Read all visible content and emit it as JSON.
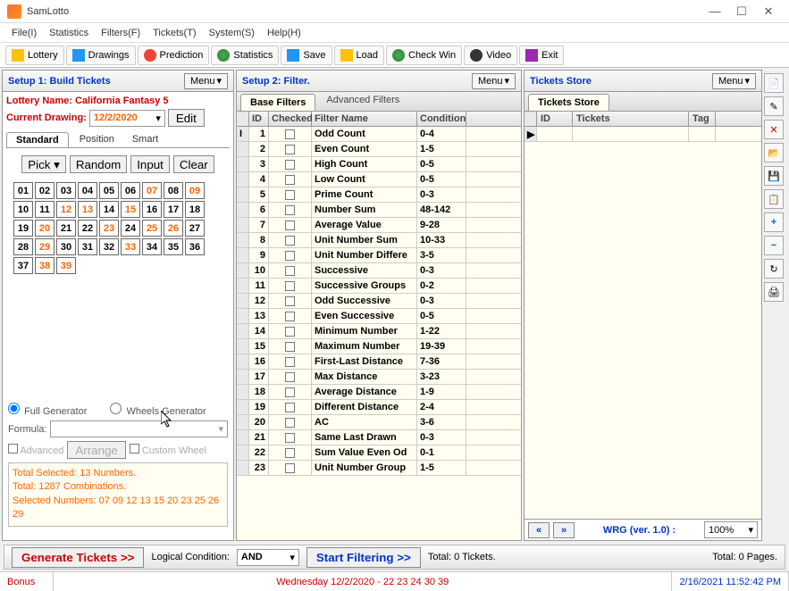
{
  "title": "SamLotto",
  "menubar": [
    "File(I)",
    "Statistics",
    "Filters(F)",
    "Tickets(T)",
    "System(S)",
    "Help(H)"
  ],
  "toolbar": [
    "Lottery",
    "Drawings",
    "Prediction",
    "Statistics",
    "Save",
    "Load",
    "Check Win",
    "Video",
    "Exit"
  ],
  "panel1": {
    "title": "Setup 1: Build  Tickets",
    "menu": "Menu",
    "lottery_label": "Lottery  Name:",
    "lottery_name": " California Fantasy 5",
    "drawing_label": "Current Drawing:",
    "drawing_date": "12/2/2020",
    "edit": "Edit",
    "tabs": [
      "Standard",
      "Position",
      "Smart"
    ],
    "btns": [
      "Pick",
      "Random",
      "Input",
      "Clear"
    ],
    "numbers": [
      "01",
      "02",
      "03",
      "04",
      "05",
      "06",
      "07",
      "08",
      "09",
      "10",
      "11",
      "12",
      "13",
      "14",
      "15",
      "16",
      "17",
      "18",
      "19",
      "20",
      "21",
      "22",
      "23",
      "24",
      "25",
      "26",
      "27",
      "28",
      "29",
      "30",
      "31",
      "32",
      "33",
      "34",
      "35",
      "36",
      "37",
      "38",
      "39"
    ],
    "selected": [
      "07",
      "09",
      "12",
      "13",
      "15",
      "20",
      "23",
      "25",
      "26",
      "29",
      "33",
      "38",
      "39"
    ],
    "gen": {
      "full": "Full Generator",
      "wheels": "Wheels Generator",
      "formula": "Formula:",
      "adv": "Advanced",
      "arrange": "Arrange",
      "custom": "Custom Wheel"
    },
    "info": [
      "Total Selected: 13 Numbers.",
      "Total: 1287 Combinations.",
      "Selected Numbers: 07 09 12 13 15 20 23 25 26 29"
    ]
  },
  "panel2": {
    "title": "Setup 2: Filter.",
    "menu": "Menu",
    "tabs": [
      "Base Filters",
      "Advanced Filters"
    ],
    "cols": [
      "ID",
      "Checked",
      "Filter Name",
      "Condition"
    ],
    "rows": [
      {
        "id": "1",
        "name": "Odd Count",
        "cond": "0-4"
      },
      {
        "id": "2",
        "name": "Even Count",
        "cond": "1-5"
      },
      {
        "id": "3",
        "name": "High Count",
        "cond": "0-5"
      },
      {
        "id": "4",
        "name": "Low Count",
        "cond": "0-5"
      },
      {
        "id": "5",
        "name": "Prime Count",
        "cond": "0-3"
      },
      {
        "id": "6",
        "name": "Number Sum",
        "cond": "48-142"
      },
      {
        "id": "7",
        "name": "Average Value",
        "cond": "9-28"
      },
      {
        "id": "8",
        "name": "Unit Number Sum",
        "cond": "10-33"
      },
      {
        "id": "9",
        "name": "Unit Number Differe",
        "cond": "3-5"
      },
      {
        "id": "10",
        "name": "Successive",
        "cond": "0-3"
      },
      {
        "id": "11",
        "name": "Successive Groups",
        "cond": "0-2"
      },
      {
        "id": "12",
        "name": "Odd Successive",
        "cond": "0-3"
      },
      {
        "id": "13",
        "name": "Even Successive",
        "cond": "0-5"
      },
      {
        "id": "14",
        "name": "Minimum Number",
        "cond": "1-22"
      },
      {
        "id": "15",
        "name": "Maximum Number",
        "cond": "19-39"
      },
      {
        "id": "16",
        "name": "First-Last Distance",
        "cond": "7-36"
      },
      {
        "id": "17",
        "name": "Max Distance",
        "cond": "3-23"
      },
      {
        "id": "18",
        "name": "Average Distance",
        "cond": "1-9"
      },
      {
        "id": "19",
        "name": "Different Distance",
        "cond": "2-4"
      },
      {
        "id": "20",
        "name": "AC",
        "cond": "3-6"
      },
      {
        "id": "21",
        "name": "Same Last Drawn",
        "cond": "0-3"
      },
      {
        "id": "22",
        "name": "Sum Value Even Od",
        "cond": "0-1"
      },
      {
        "id": "23",
        "name": "Unit Number Group",
        "cond": "1-5"
      }
    ]
  },
  "panel3": {
    "title": "Tickets Store",
    "menu": "Menu",
    "tab": "Tickets Store",
    "cols": [
      "ID",
      "Tickets",
      "Tag"
    ],
    "wrg": "WRG  (ver. 1.0) :",
    "zoom": "100%"
  },
  "bottom": {
    "gen": "Generate Tickets >>",
    "logical": "Logical Condition:",
    "and": "AND",
    "filter": "Start Filtering >>",
    "total_t": "Total: 0 Tickets.",
    "total_p": "Total: 0 Pages."
  },
  "status": {
    "bonus": "Bonus",
    "date": "Wednesday 12/2/2020 - 22 23 24 30 39",
    "time": "2/16/2021 11:52:42 PM"
  }
}
